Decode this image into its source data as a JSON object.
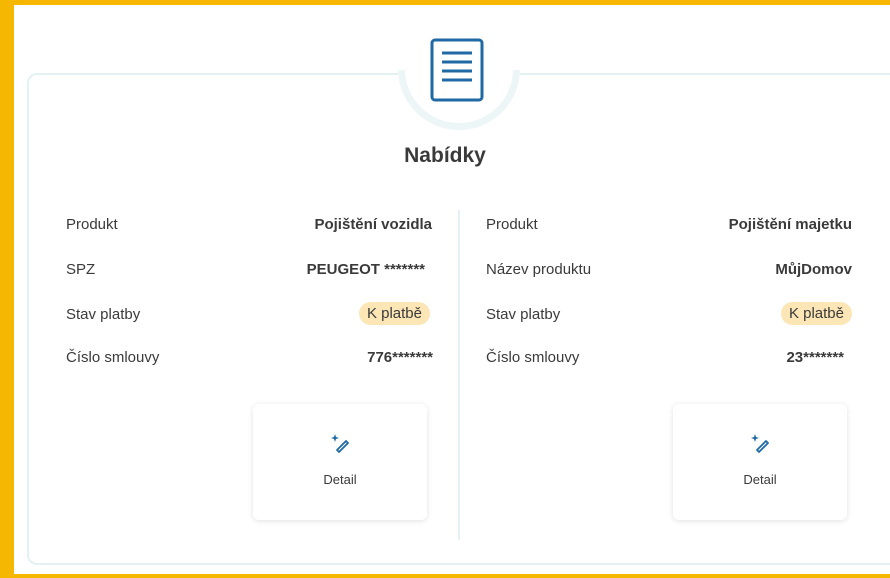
{
  "section": {
    "title": "Nabídky"
  },
  "offers": [
    {
      "rows": [
        {
          "label": "Produkt",
          "value": "Pojištění vozidla"
        },
        {
          "label": "SPZ",
          "value": "PEUGEOT *******"
        },
        {
          "label": "Stav platby",
          "value": "K platbě"
        },
        {
          "label": "Číslo smlouvy",
          "value": "776*******"
        }
      ],
      "detail_label": "Detail"
    },
    {
      "rows": [
        {
          "label": "Produkt",
          "value": "Pojištění majetku"
        },
        {
          "label": "Název produktu",
          "value": "MůjDomov"
        },
        {
          "label": "Stav platby",
          "value": "K platbě"
        },
        {
          "label": "Číslo smlouvy",
          "value": "23*******"
        }
      ],
      "detail_label": "Detail"
    }
  ],
  "icons": {
    "header": "document-icon",
    "detail": "magic-wand-icon"
  },
  "colors": {
    "accent_frame": "#f6b700",
    "icon_blue": "#1f6aa5",
    "badge_bg": "#fce6b6",
    "card_border": "#e3f1f3"
  }
}
